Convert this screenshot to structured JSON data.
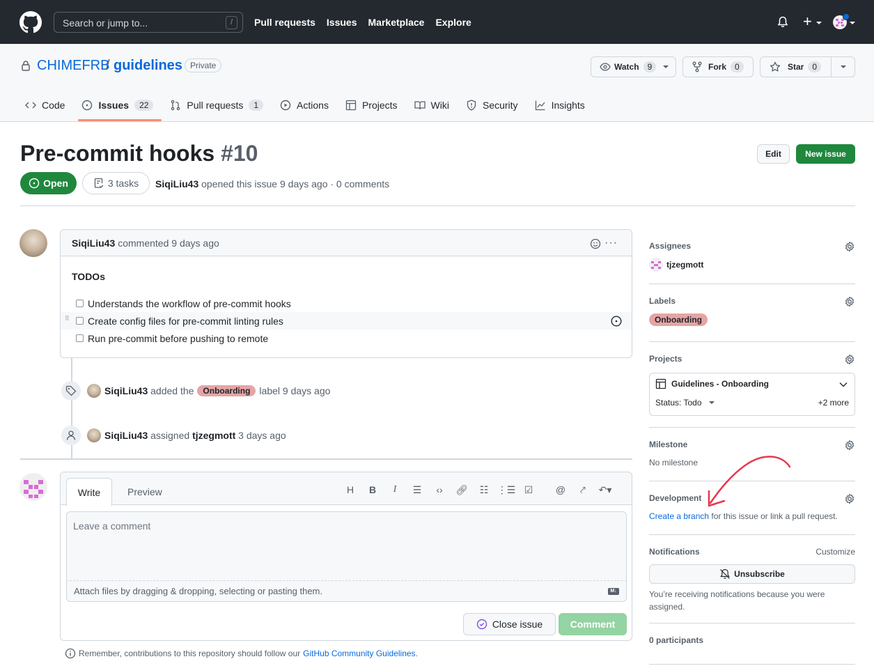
{
  "topbar": {
    "search_placeholder": "Search or jump to...",
    "search_shortcut": "/",
    "nav": [
      "Pull requests",
      "Issues",
      "Marketplace",
      "Explore"
    ]
  },
  "repo": {
    "owner": "CHIMEFRB",
    "separator": "/",
    "name": "guidelines",
    "visibility": "Private",
    "watch": {
      "label": "Watch",
      "count": "9"
    },
    "fork": {
      "label": "Fork",
      "count": "0"
    },
    "star": {
      "label": "Star",
      "count": "0"
    },
    "tabs": [
      {
        "label": "Code",
        "icon": "code-icon"
      },
      {
        "label": "Issues",
        "count": "22",
        "icon": "issue-opened-icon",
        "selected": true
      },
      {
        "label": "Pull requests",
        "count": "1",
        "icon": "git-pull-request-icon"
      },
      {
        "label": "Actions",
        "icon": "play-icon"
      },
      {
        "label": "Projects",
        "icon": "table-icon"
      },
      {
        "label": "Wiki",
        "icon": "book-icon"
      },
      {
        "label": "Security",
        "icon": "shield-icon"
      },
      {
        "label": "Insights",
        "icon": "graph-icon"
      }
    ]
  },
  "issue": {
    "title": "Pre-commit hooks",
    "number": "#10",
    "edit_label": "Edit",
    "new_issue_label": "New issue",
    "state": "Open",
    "tasks": "3 tasks",
    "author": "SiqiLiu43",
    "meta": "opened this issue 9 days ago · 0 comments"
  },
  "comment": {
    "author": "SiqiLiu43",
    "meta": "commented 9 days ago",
    "heading": "TODOs",
    "tasks": [
      "Understands the workflow of pre-commit hooks",
      "Create config files for pre-commit linting rules",
      "Run pre-commit before pushing to remote"
    ]
  },
  "timeline": [
    {
      "actor": "SiqiLiu43",
      "text1": "added the",
      "label": "Onboarding",
      "text2": "label 9 days ago"
    },
    {
      "actor": "SiqiLiu43",
      "text1": "assigned",
      "target": "tjzegmott",
      "text2": "3 days ago"
    }
  ],
  "editor": {
    "tab_write": "Write",
    "tab_preview": "Preview",
    "placeholder": "Leave a comment",
    "attach_text": "Attach files by dragging & dropping, selecting or pasting them.",
    "markdown_badge": "M↓",
    "close_issue_label": "Close issue",
    "comment_label": "Comment",
    "remember_text": "Remember, contributions to this repository should follow our",
    "guidelines_link": "GitHub Community Guidelines",
    "remember_end": "."
  },
  "sidebar": {
    "assignees": {
      "heading": "Assignees",
      "user": "tjzegmott"
    },
    "labels": {
      "heading": "Labels",
      "label": "Onboarding",
      "label_color": "#e4a5a5"
    },
    "projects": {
      "heading": "Projects",
      "project": "Guidelines - Onboarding",
      "status": "Status: Todo",
      "more": "+2 more"
    },
    "milestone": {
      "heading": "Milestone",
      "value": "No milestone"
    },
    "development": {
      "heading": "Development",
      "link": "Create a branch",
      "text": "for this issue or link a pull request."
    },
    "notifications": {
      "heading": "Notifications",
      "customize": "Customize",
      "unsubscribe": "Unsubscribe",
      "reason": "You’re receiving notifications because you were assigned."
    },
    "participants": "0 participants"
  },
  "colors": {
    "accent": "#0969da",
    "open_green": "#1f883d",
    "annotation_arrow": "#e8384f"
  }
}
